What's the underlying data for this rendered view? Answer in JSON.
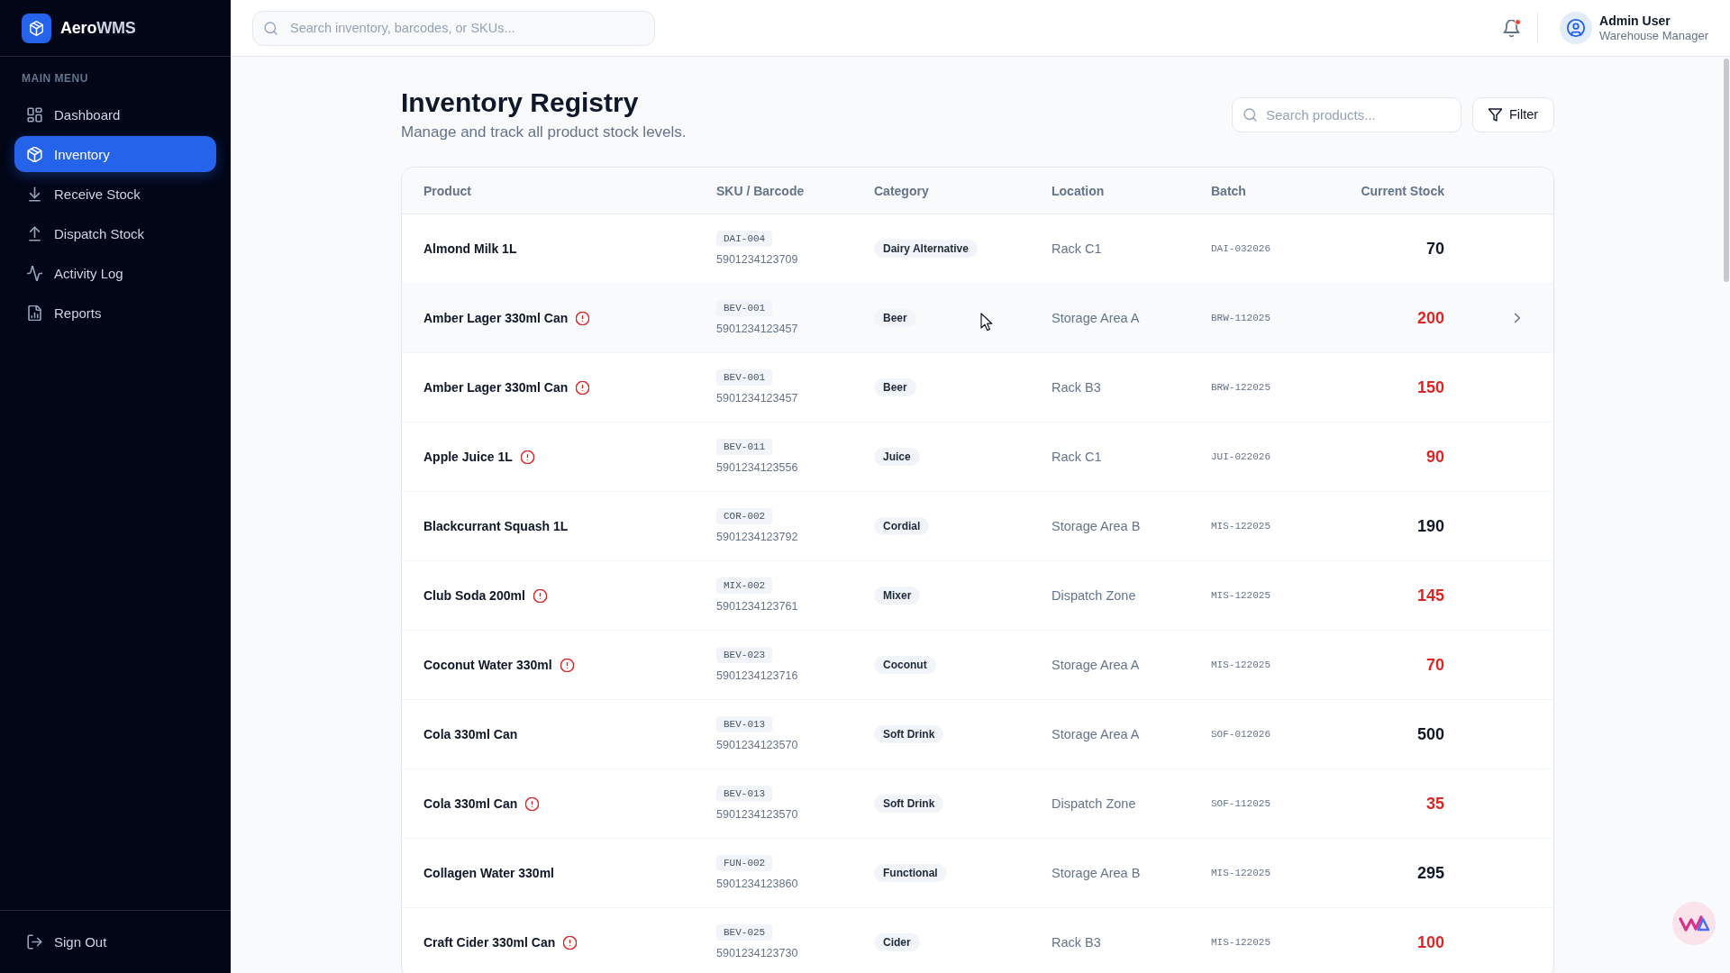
{
  "sidebar": {
    "brand": {
      "name": "Aero",
      "suffix": "WMS"
    },
    "section_label": "MAIN MENU",
    "items": [
      {
        "label": "Dashboard",
        "selected": false
      },
      {
        "label": "Inventory",
        "selected": true
      },
      {
        "label": "Receive Stock",
        "selected": false
      },
      {
        "label": "Dispatch Stock",
        "selected": false
      },
      {
        "label": "Activity Log",
        "selected": false
      },
      {
        "label": "Reports",
        "selected": false
      }
    ],
    "sign_out": "Sign Out"
  },
  "topbar": {
    "search": {
      "placeholder": "Search inventory, barcodes, or SKUs..."
    },
    "notifications": {
      "unread": true
    },
    "user": {
      "name": "Admin User",
      "role": "Warehouse Manager"
    }
  },
  "page": {
    "title": "Inventory Registry",
    "subtitle": "Manage and track all product stock levels.",
    "search": {
      "placeholder": "Search products..."
    },
    "filter_button": "Filter"
  },
  "table": {
    "columns": [
      "Product",
      "SKU / Barcode",
      "Category",
      "Location",
      "Batch",
      "Current Stock"
    ],
    "rows": [
      {
        "product": "Almond Milk 1L",
        "low_stock": false,
        "sku": "DAI-004",
        "barcode": "5901234123709",
        "category": "Dairy Alternative",
        "location": "Rack C1",
        "batch": "DAI-032026",
        "stock": "70",
        "hovered": false
      },
      {
        "product": "Amber Lager 330ml Can",
        "low_stock": true,
        "sku": "BEV-001",
        "barcode": "5901234123457",
        "category": "Beer",
        "location": "Storage Area A",
        "batch": "BRW-112025",
        "stock": "200",
        "hovered": true
      },
      {
        "product": "Amber Lager 330ml Can",
        "low_stock": true,
        "sku": "BEV-001",
        "barcode": "5901234123457",
        "category": "Beer",
        "location": "Rack B3",
        "batch": "BRW-122025",
        "stock": "150",
        "hovered": false
      },
      {
        "product": "Apple Juice 1L",
        "low_stock": true,
        "sku": "BEV-011",
        "barcode": "5901234123556",
        "category": "Juice",
        "location": "Rack C1",
        "batch": "JUI-022026",
        "stock": "90",
        "hovered": false
      },
      {
        "product": "Blackcurrant Squash 1L",
        "low_stock": false,
        "sku": "COR-002",
        "barcode": "5901234123792",
        "category": "Cordial",
        "location": "Storage Area B",
        "batch": "MIS-122025",
        "stock": "190",
        "hovered": false
      },
      {
        "product": "Club Soda 200ml",
        "low_stock": true,
        "sku": "MIX-002",
        "barcode": "5901234123761",
        "category": "Mixer",
        "location": "Dispatch Zone",
        "batch": "MIS-122025",
        "stock": "145",
        "hovered": false
      },
      {
        "product": "Coconut Water 330ml",
        "low_stock": true,
        "sku": "BEV-023",
        "barcode": "5901234123716",
        "category": "Coconut",
        "location": "Storage Area A",
        "batch": "MIS-122025",
        "stock": "70",
        "hovered": false
      },
      {
        "product": "Cola 330ml Can",
        "low_stock": false,
        "sku": "BEV-013",
        "barcode": "5901234123570",
        "category": "Soft Drink",
        "location": "Storage Area A",
        "batch": "SOF-012026",
        "stock": "500",
        "hovered": false
      },
      {
        "product": "Cola 330ml Can",
        "low_stock": true,
        "sku": "BEV-013",
        "barcode": "5901234123570",
        "category": "Soft Drink",
        "location": "Dispatch Zone",
        "batch": "SOF-112025",
        "stock": "35",
        "hovered": false
      },
      {
        "product": "Collagen Water 330ml",
        "low_stock": false,
        "sku": "FUN-002",
        "barcode": "5901234123860",
        "category": "Functional",
        "location": "Storage Area B",
        "batch": "MIS-122025",
        "stock": "295",
        "hovered": false
      },
      {
        "product": "Craft Cider 330ml Can",
        "low_stock": true,
        "sku": "BEV-025",
        "barcode": "5901234123730",
        "category": "Cider",
        "location": "Rack B3",
        "batch": "MIS-122025",
        "stock": "100",
        "hovered": false
      }
    ]
  }
}
